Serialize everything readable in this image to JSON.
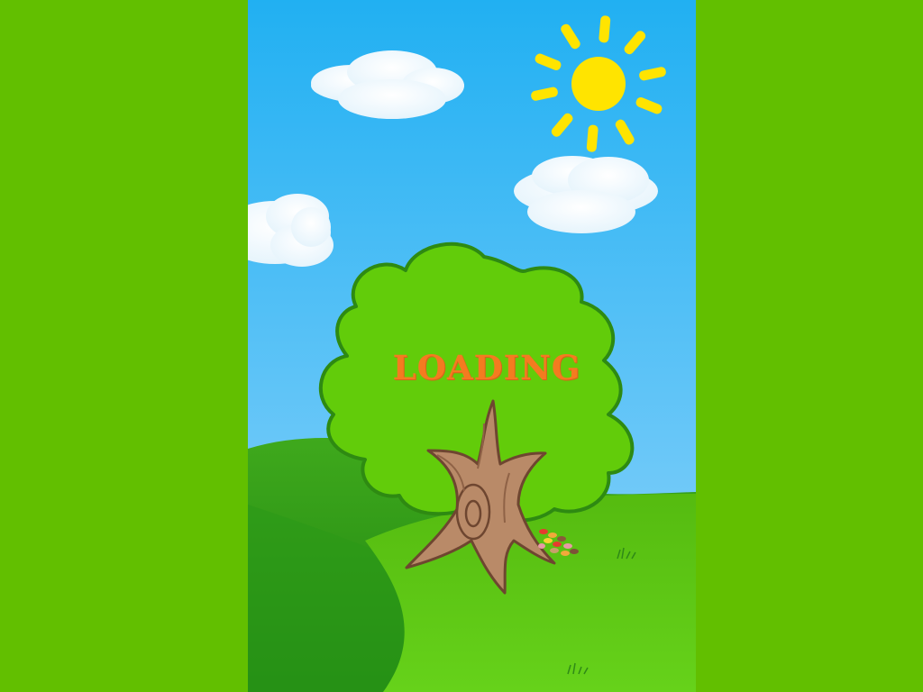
{
  "loading_screen": {
    "label": "LOADING"
  },
  "colors": {
    "side_background": "#62bf00",
    "sky_top": "#21b0f2",
    "sky_bottom": "#8fd3fb",
    "hill_front": "#5cc213",
    "hill_back": "#2f9b1a",
    "foliage": "#62cc0a",
    "foliage_outline": "#2e8a12",
    "trunk": "#b98a68",
    "trunk_outline": "#6e4630",
    "sun": "#ffe400",
    "label": "#f47b20"
  }
}
